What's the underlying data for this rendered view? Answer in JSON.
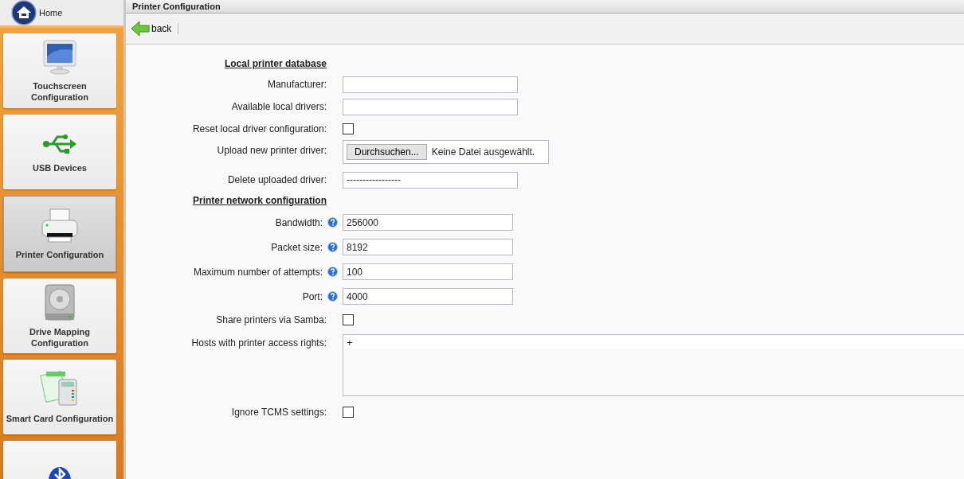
{
  "sidebar": {
    "home": {
      "label": "Home"
    },
    "items": [
      {
        "label": "Touchscreen Configuration",
        "selected": false
      },
      {
        "label": "USB Devices",
        "selected": false
      },
      {
        "label": "Printer Configuration",
        "selected": true
      },
      {
        "label": "Drive Mapping Configuration",
        "selected": false
      },
      {
        "label": "Smart Card Configuration",
        "selected": false
      },
      {
        "selected": false
      }
    ]
  },
  "panel": {
    "title": "Printer Configuration",
    "toolbar": {
      "back": "back"
    }
  },
  "form": [
    {
      "kind": "heading",
      "label": "Local printer database"
    },
    {
      "kind": "text",
      "label": "Manufacturer:"
    },
    {
      "kind": "text",
      "label": "Available local drivers:"
    },
    {
      "kind": "checkbox",
      "label": "Reset local driver configuration:",
      "checked": false
    },
    {
      "kind": "file",
      "label": "Upload new printer driver:",
      "button": "Durchsuchen...",
      "status": "Keine Datei ausgewählt."
    },
    {
      "kind": "select",
      "label": "Delete uploaded driver:",
      "value": "-----------------"
    },
    {
      "kind": "heading",
      "label": "Printer network configuration"
    },
    {
      "kind": "number",
      "label": "Bandwidth:",
      "help": true,
      "value": "256000"
    },
    {
      "kind": "number",
      "label": "Packet size:",
      "help": true,
      "value": "8192"
    },
    {
      "kind": "number",
      "label": "Maximum number of attempts:",
      "help": true,
      "value": "100"
    },
    {
      "kind": "number",
      "label": "Port:",
      "help": true,
      "value": "4000"
    },
    {
      "kind": "checkbox",
      "label": "Share printers via Samba:",
      "checked": false
    },
    {
      "kind": "list",
      "label": "Hosts with printer access rights:",
      "add": "+"
    },
    {
      "kind": "checkbox",
      "label": "Ignore TCMS settings:",
      "checked": false
    }
  ]
}
